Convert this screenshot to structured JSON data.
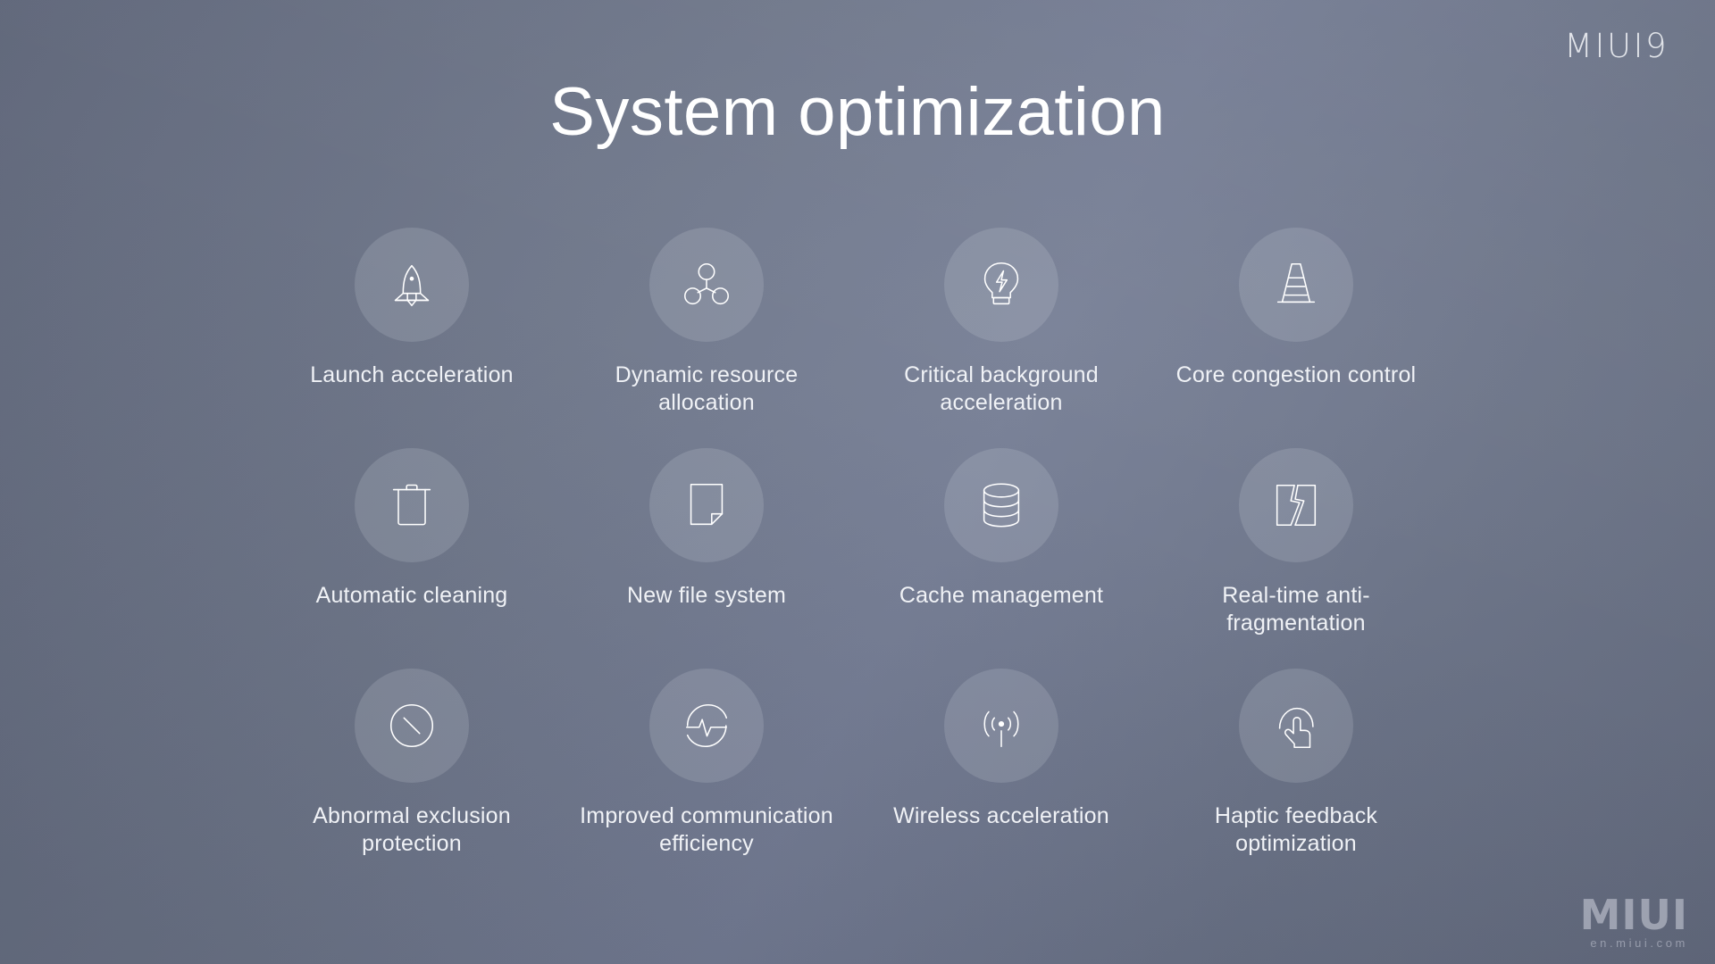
{
  "brand": {
    "logo_text": "MIUI9"
  },
  "header": {
    "title": "System optimization"
  },
  "watermark": {
    "main": "MIUI",
    "sub": "en.miui.com"
  },
  "theme": {
    "background_start": "#5f6679",
    "background_mid": "#707890",
    "background_end": "#5e6578",
    "badge_fill": "rgba(223,228,238,0.16)",
    "icon_color": "#ffffff",
    "text_color": "#f0f2f6",
    "title_color": "#ffffff"
  },
  "features": [
    {
      "icon": "rocket-icon",
      "label": "Launch acceleration"
    },
    {
      "icon": "resource-nodes-icon",
      "label": "Dynamic resource allocation"
    },
    {
      "icon": "lightbulb-bolt-icon",
      "label": "Critical background acceleration"
    },
    {
      "icon": "traffic-cone-icon",
      "label": "Core congestion control"
    },
    {
      "icon": "trash-can-icon",
      "label": "Automatic cleaning"
    },
    {
      "icon": "file-document-icon",
      "label": "New file system"
    },
    {
      "icon": "database-stack-icon",
      "label": "Cache management"
    },
    {
      "icon": "fragmented-block-icon",
      "label": "Real-time anti-fragmentation"
    },
    {
      "icon": "prohibition-circle-icon",
      "label": "Abnormal exclusion protection"
    },
    {
      "icon": "pulse-circle-icon",
      "label": "Improved communication efficiency"
    },
    {
      "icon": "broadcast-antenna-icon",
      "label": "Wireless acceleration"
    },
    {
      "icon": "tap-gesture-icon",
      "label": "Haptic feedback optimization"
    }
  ]
}
